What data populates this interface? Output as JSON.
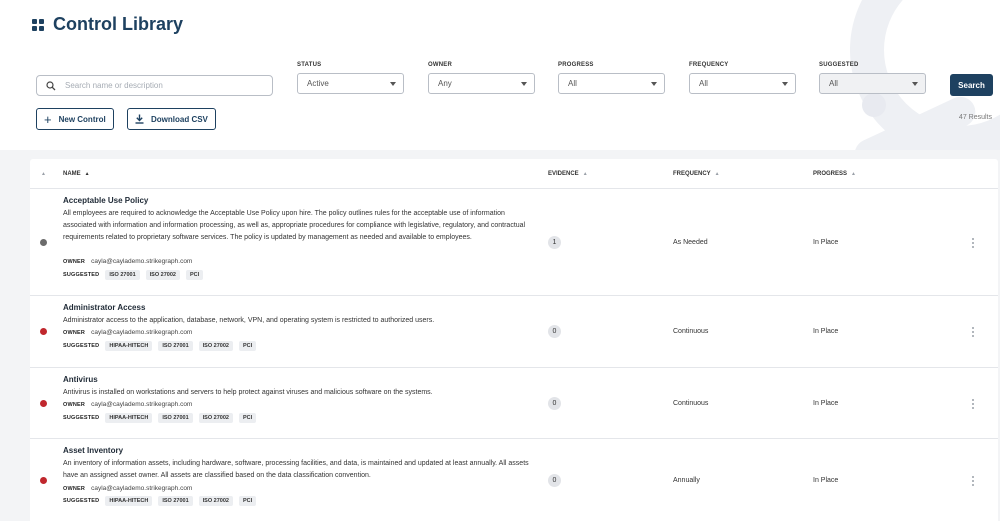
{
  "header": {
    "title": "Control Library"
  },
  "search": {
    "placeholder": "Search name or description",
    "button_label": "Search"
  },
  "filters": [
    {
      "label": "STATUS",
      "value": "Active"
    },
    {
      "label": "OWNER",
      "value": "Any"
    },
    {
      "label": "PROGRESS",
      "value": "All"
    },
    {
      "label": "FREQUENCY",
      "value": "All"
    },
    {
      "label": "SUGGESTED",
      "value": "All"
    }
  ],
  "actions": {
    "new_control": "New Control",
    "download_csv": "Download CSV"
  },
  "results_text": "47 Results",
  "table": {
    "columns": {
      "name": "NAME",
      "evidence": "EVIDENCE",
      "frequency": "FREQUENCY",
      "progress": "PROGRESS"
    },
    "owner_label": "OWNER",
    "suggested_label": "SUGGESTED",
    "rows": [
      {
        "name": "Acceptable Use Policy",
        "desc": "All employees are required to acknowledge the Acceptable Use Policy upon hire. The policy outlines rules for the acceptable use of information associated with information and information processing, as well as, appropriate procedures for compliance with legislative, regulatory, and contractual requirements related to proprietary software services. The policy is updated by management as needed and available to employees.",
        "owner": "cayla@caylademo.strikegraph.com",
        "tags": [
          "ISO 27001",
          "ISO 27002",
          "PCI"
        ],
        "evidence": "1",
        "frequency": "As Needed",
        "progress": "In Place",
        "status_color": "#6b6b6b"
      },
      {
        "name": "Administrator Access",
        "desc": "Administrator access to the application, database, network, VPN, and operating system is restricted to authorized users.",
        "owner": "cayla@caylademo.strikegraph.com",
        "tags": [
          "HIPAA-HITECH",
          "ISO 27001",
          "ISO 27002",
          "PCI"
        ],
        "evidence": "0",
        "frequency": "Continuous",
        "progress": "In Place",
        "status_color": "#c0272d"
      },
      {
        "name": "Antivirus",
        "desc": "Antivirus is installed on workstations and servers to help protect against viruses and malicious software on the systems.",
        "owner": "cayla@caylademo.strikegraph.com",
        "tags": [
          "HIPAA-HITECH",
          "ISO 27001",
          "ISO 27002",
          "PCI"
        ],
        "evidence": "0",
        "frequency": "Continuous",
        "progress": "In Place",
        "status_color": "#c0272d"
      },
      {
        "name": "Asset Inventory",
        "desc": "An inventory of information assets, including hardware, software, processing facilities, and data, is maintained and updated at least annually. All assets have an assigned asset owner. All assets are classified based on the data classification convention.",
        "owner": "cayla@caylademo.strikegraph.com",
        "tags": [
          "HIPAA-HITECH",
          "ISO 27001",
          "ISO 27002",
          "PCI"
        ],
        "evidence": "0",
        "frequency": "Annually",
        "progress": "In Place",
        "status_color": "#c0272d"
      }
    ]
  }
}
